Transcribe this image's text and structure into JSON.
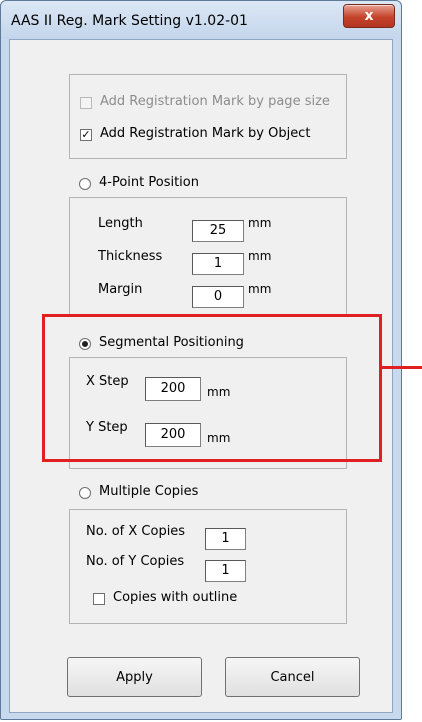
{
  "window": {
    "title": "AAS II Reg. Mark Setting v1.02-01",
    "close_glyph": "x"
  },
  "registration": {
    "by_page_size": {
      "label": "Add Registration Mark by page size",
      "checked": false,
      "enabled": false
    },
    "by_object": {
      "label": "Add Registration Mark by Object",
      "checked": true,
      "mark": "✓"
    }
  },
  "four_point": {
    "label": "4-Point Position",
    "selected": false,
    "length": {
      "label": "Length",
      "value": "25",
      "unit": "mm"
    },
    "thickness": {
      "label": "Thickness",
      "value": "1",
      "unit": "mm"
    },
    "margin": {
      "label": "Margin",
      "value": "0",
      "unit": "mm"
    }
  },
  "segmental": {
    "label": "Segmental Positioning",
    "selected": true,
    "x_step": {
      "label": "X Step",
      "value": "200",
      "unit": "mm"
    },
    "y_step": {
      "label": "Y Step",
      "value": "200",
      "unit": "mm"
    }
  },
  "multiple": {
    "label": "Multiple Copies",
    "selected": false,
    "x_copies": {
      "label": "No. of X Copies",
      "value": "1"
    },
    "y_copies": {
      "label": "No. of Y Copies",
      "value": "1"
    },
    "outline": {
      "label": "Copies with outline",
      "checked": false
    }
  },
  "buttons": {
    "apply": "Apply",
    "cancel": "Cancel"
  },
  "colors": {
    "highlight": "#e02020",
    "close_button": "#c4432b",
    "dialog_bg": "#f0f0f0"
  }
}
